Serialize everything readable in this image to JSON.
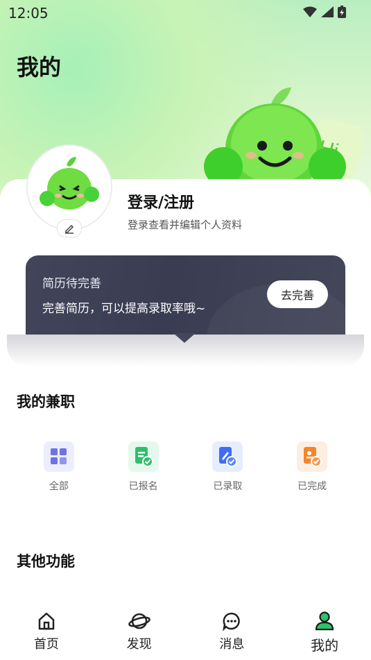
{
  "status_bar": {
    "time": "12:05"
  },
  "header": {
    "title": "我的"
  },
  "profile": {
    "login_title": "登录/注册",
    "login_subtitle": "登录查看并编辑个人资料"
  },
  "resume_card": {
    "title": "简历待完善",
    "description": "完善简历，可以提高录取率哦~",
    "button_label": "去完善"
  },
  "my_jobs": {
    "title": "我的兼职",
    "items": [
      {
        "label": "全部",
        "icon": "grid-icon",
        "color": "#6d72e8"
      },
      {
        "label": "已报名",
        "icon": "doc-check-icon",
        "color": "#2fbf6a"
      },
      {
        "label": "已录取",
        "icon": "doc-edit-icon",
        "color": "#3d6ef0"
      },
      {
        "label": "已完成",
        "icon": "doc-done-icon",
        "color": "#f3862d"
      }
    ]
  },
  "other": {
    "title": "其他功能"
  },
  "tabbar": {
    "items": [
      {
        "label": "首页",
        "icon": "home-icon"
      },
      {
        "label": "发现",
        "icon": "planet-icon"
      },
      {
        "label": "消息",
        "icon": "message-icon"
      },
      {
        "label": "我的",
        "icon": "user-icon",
        "active": true
      }
    ]
  },
  "colors": {
    "accent": "#2cc46b",
    "dark_card": "#3d3f55"
  }
}
